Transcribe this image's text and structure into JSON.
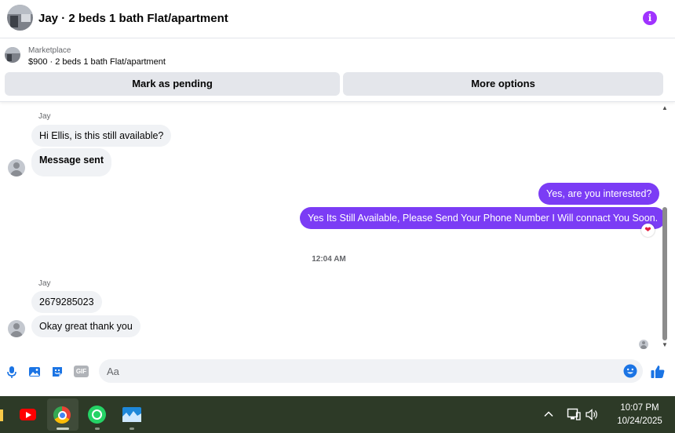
{
  "header": {
    "title": "Jay · 2 beds 1 bath Flat/apartment",
    "info_icon": "info-icon",
    "accent": "#a033ff"
  },
  "marketplace": {
    "label": "Marketplace",
    "detail": "$900 · 2 beds 1 bath Flat/apartment",
    "pending_label": "Mark as pending",
    "more_label": "More options"
  },
  "messages": {
    "group1": {
      "sender": "Jay",
      "bubbles": [
        "Hi Ellis, is this still available?",
        "Message sent"
      ]
    },
    "outgoing": [
      "Yes, are you interested?",
      "Yes Its Still Available, Please Send Your Phone Number I Will connact You Soon."
    ],
    "reaction": "❤",
    "timestamp": "12:04 AM",
    "group2": {
      "sender": "Jay",
      "bubbles": [
        "2679285023",
        "Okay great thank you"
      ]
    },
    "outgoing_color": "#7b3cf5",
    "incoming_color": "#f0f2f5"
  },
  "composer": {
    "placeholder": "Aa",
    "icons": [
      "microphone-icon",
      "photo-icon",
      "sticker-icon",
      "gif-icon",
      "emoji-icon",
      "like-icon"
    ],
    "gif_label": "GIF"
  },
  "taskbar": {
    "time": "10:07 PM",
    "date": "10/24/2025",
    "apps": [
      "file-explorer-icon",
      "youtube-icon",
      "chrome-icon",
      "whatsapp-icon",
      "photos-icon"
    ],
    "tray": [
      "chevron-up-icon",
      "network-icon",
      "volume-icon"
    ]
  }
}
